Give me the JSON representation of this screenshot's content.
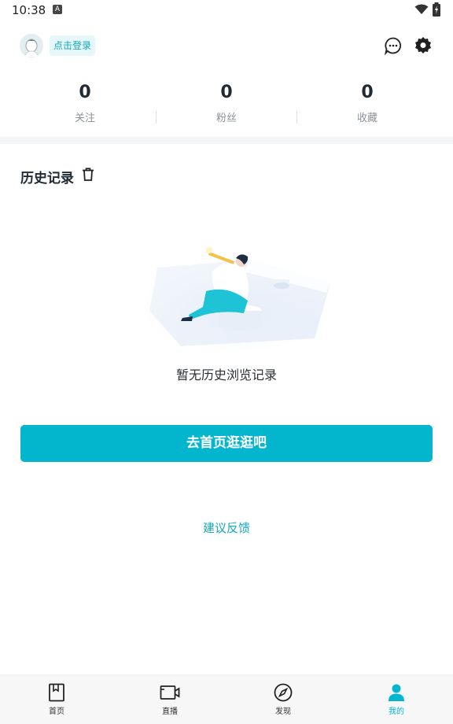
{
  "status_bar": {
    "time": "10:38",
    "notification_glyph": "A"
  },
  "header": {
    "login_label": "点击登录"
  },
  "stats": [
    {
      "value": "0",
      "label": "关注"
    },
    {
      "value": "0",
      "label": "粉丝"
    },
    {
      "value": "0",
      "label": "收藏"
    }
  ],
  "history": {
    "title": "历史记录",
    "empty_text": "暂无历史浏览记录"
  },
  "actions": {
    "home_button": "去首页逛逛吧",
    "feedback_link": "建议反馈"
  },
  "tabbar": {
    "items": [
      {
        "label": "首页",
        "icon": "book-icon"
      },
      {
        "label": "直播",
        "icon": "video-camera-icon"
      },
      {
        "label": "发现",
        "icon": "compass-icon"
      },
      {
        "label": "我的",
        "icon": "person-icon",
        "active": true
      }
    ]
  },
  "colors": {
    "accent": "#03b6ce",
    "accent_text": "#14a8bd",
    "band": "#f2f6f6"
  }
}
